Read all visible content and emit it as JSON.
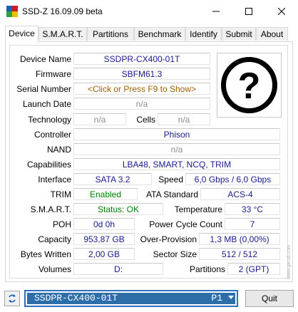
{
  "window": {
    "title": "SSD-Z 16.09.09 beta",
    "icon_colors": [
      "#1a5fb4",
      "#d01c1c",
      "#2ea043",
      "#e8c000"
    ]
  },
  "tabs": [
    "Device",
    "S.M.A.R.T.",
    "Partitions",
    "Benchmark",
    "Identify",
    "Submit",
    "About"
  ],
  "active_tab": "Device",
  "device": {
    "device_name_label": "Device Name",
    "device_name": "SSDPR-CX400-01T",
    "firmware_label": "Firmware",
    "firmware": "SBFM61.3",
    "serial_label": "Serial Number",
    "serial": "<Click or Press F9 to Show>",
    "launch_date_label": "Launch Date",
    "launch_date": "n/a",
    "technology_label": "Technology",
    "technology": "n/a",
    "cells_label": "Cells",
    "cells": "n/a",
    "controller_label": "Controller",
    "controller": "Phison",
    "nand_label": "NAND",
    "nand": "n/a",
    "capabilities_label": "Capabilities",
    "capabilities": "LBA48, SMART, NCQ, TRIM",
    "interface_label": "Interface",
    "interface": "SATA 3.2",
    "speed_label": "Speed",
    "speed": "6,0 Gbps / 6,0 Gbps",
    "trim_label": "TRIM",
    "trim": "Enabled",
    "ata_label": "ATA Standard",
    "ata": "ACS-4",
    "smart_label": "S.M.A.R.T.",
    "smart": "Status: OK",
    "temperature_label": "Temperature",
    "temperature": "33 °C",
    "poh_label": "POH",
    "poh": "0d 0h",
    "pcc_label": "Power Cycle Count",
    "pcc": "7",
    "capacity_label": "Capacity",
    "capacity": "953,87 GB",
    "overprov_label": "Over-Provision",
    "overprov": "1,3 MB (0,00%)",
    "bytes_written_label": "Bytes Written",
    "bytes_written": "2,00 GB",
    "sector_label": "Sector Size",
    "sector": "512 / 512",
    "volumes_label": "Volumes",
    "volumes": "D:",
    "partitions_label": "Partitions",
    "partitions": "2 (GPT)",
    "logo_glyph": "?"
  },
  "bottom": {
    "selected_drive": "SSDPR-CX400-01T",
    "drive_badge": "P1",
    "quit_label": "Quit",
    "watermark": "www.gecid.com"
  },
  "colors": {
    "accent": "#2d6ea9",
    "value_blue": "#1a1a8c",
    "ok_green": "#008000",
    "muted_gray": "#8c8c8c"
  }
}
